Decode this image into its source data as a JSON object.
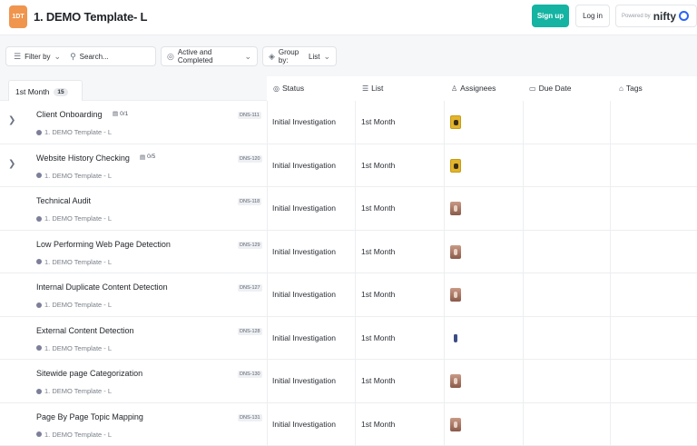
{
  "header": {
    "logo_text": "1DT",
    "title": "1. DEMO Template- L",
    "signup_label": "Sign up",
    "login_label": "Log in",
    "powered_by": "Powered by",
    "brand": "nifty",
    "accent_color": "#14b3a2",
    "logo_color": "#f0954e"
  },
  "toolbar": {
    "filter_label": "Filter by",
    "search_placeholder": "Search...",
    "status_filter_label": "Active and Completed",
    "group_by_label": "Group by:",
    "group_by_value": "List"
  },
  "group": {
    "label": "1st Month",
    "count": "15"
  },
  "columns": {
    "status": "Status",
    "list": "List",
    "assignees": "Assignees",
    "due_date": "Due Date",
    "tags": "Tags"
  },
  "tasks": [
    {
      "name": "Client Onboarding",
      "subtasks": "0/1",
      "project": "1. DEMO Template - L",
      "code": "DNS-111",
      "status": "Initial Investigation",
      "list": "1st Month",
      "has_children": true,
      "avatar": "yellow"
    },
    {
      "name": "Website History Checking",
      "subtasks": "0/5",
      "project": "1. DEMO Template - L",
      "code": "DNS-120",
      "status": "Initial Investigation",
      "list": "1st Month",
      "has_children": true,
      "avatar": "yellow"
    },
    {
      "name": "Technical Audit",
      "subtasks": "",
      "project": "1. DEMO Template - L",
      "code": "DNS-118",
      "status": "Initial Investigation",
      "list": "1st Month",
      "has_children": false,
      "avatar": "photo"
    },
    {
      "name": "Low Performing Web Page Detection",
      "subtasks": "",
      "project": "1. DEMO Template - L",
      "code": "DNS-129",
      "status": "Initial Investigation",
      "list": "1st Month",
      "has_children": false,
      "avatar": "photo"
    },
    {
      "name": "Internal Duplicate Content Detection",
      "subtasks": "",
      "project": "1. DEMO Template - L",
      "code": "DNS-127",
      "status": "Initial Investigation",
      "list": "1st Month",
      "has_children": false,
      "avatar": "photo"
    },
    {
      "name": "External Content Detection",
      "subtasks": "",
      "project": "1. DEMO Template - L",
      "code": "DNS-128",
      "status": "Initial Investigation",
      "list": "1st Month",
      "has_children": false,
      "avatar": "small"
    },
    {
      "name": "Sitewide page Categorization",
      "subtasks": "",
      "project": "1. DEMO Template - L",
      "code": "DNS-130",
      "status": "Initial Investigation",
      "list": "1st Month",
      "has_children": false,
      "avatar": "photo"
    },
    {
      "name": "Page By Page Topic Mapping",
      "subtasks": "",
      "project": "1. DEMO Template - L",
      "code": "DNS-131",
      "status": "Initial Investigation",
      "list": "1st Month",
      "has_children": false,
      "avatar": "photo"
    }
  ]
}
